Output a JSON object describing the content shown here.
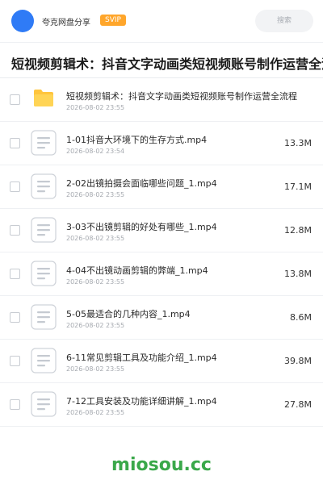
{
  "header": {
    "username": "夸克网盘分享",
    "badge": "SVIP",
    "search_placeholder": "搜索"
  },
  "share_title": "短视频剪辑术：抖音文字动画类短视频账号制作运营全流程",
  "files": [
    {
      "type": "folder",
      "name": "短视频剪辑术：抖音文字动画类短视频账号制作运营全流程",
      "date": "2026-08-02 23:55",
      "size": ""
    },
    {
      "type": "file",
      "name": "1-01抖音大环境下的生存方式.mp4",
      "date": "2026-08-02 23:54",
      "size": "13.3M"
    },
    {
      "type": "file",
      "name": "2-02出镜拍摄会面临哪些问题_1.mp4",
      "date": "2026-08-02 23:55",
      "size": "17.1M"
    },
    {
      "type": "file",
      "name": "3-03不出镜剪辑的好处有哪些_1.mp4",
      "date": "2026-08-02 23:55",
      "size": "12.8M"
    },
    {
      "type": "file",
      "name": "4-04不出镜动画剪辑的弊端_1.mp4",
      "date": "2026-08-02 23:55",
      "size": "13.8M"
    },
    {
      "type": "file",
      "name": "5-05最适合的几种内容_1.mp4",
      "date": "2026-08-02 23:55",
      "size": "8.6M"
    },
    {
      "type": "file",
      "name": "6-11常见剪辑工具及功能介绍_1.mp4",
      "date": "2026-08-02 23:55",
      "size": "39.8M"
    },
    {
      "type": "file",
      "name": "7-12工具安装及功能详细讲解_1.mp4",
      "date": "2026-08-02 23:55",
      "size": "27.8M"
    }
  ],
  "watermark": "miosou.cc",
  "colors": {
    "avatar": "#2f7bf6",
    "badge": "#ffa62b",
    "folder": "#ffc53d",
    "watermark": "#3aa84a"
  }
}
